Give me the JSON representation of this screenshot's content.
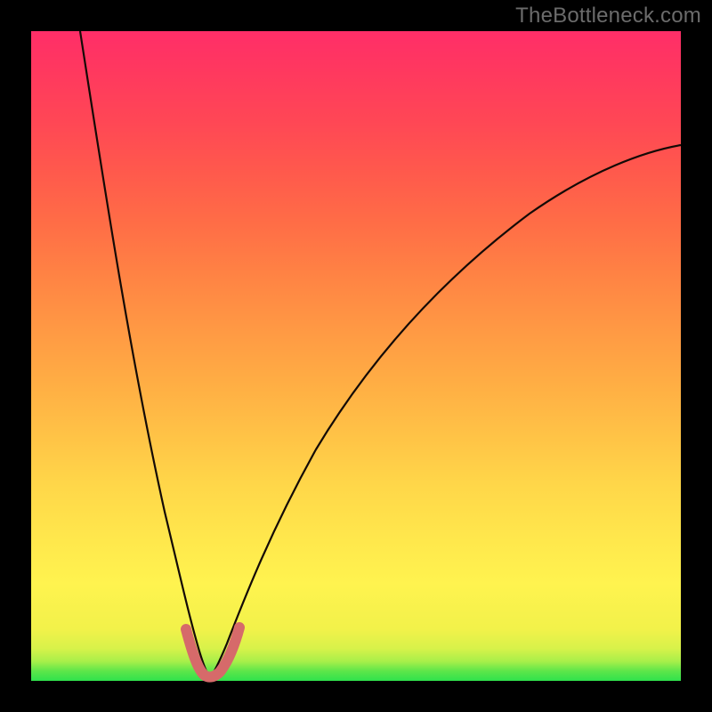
{
  "watermark": "TheBottleneck.com",
  "chart_data": {
    "type": "line",
    "title": "",
    "xlabel": "",
    "ylabel": "",
    "xlim": [
      0,
      1
    ],
    "ylim": [
      0,
      1
    ],
    "note": "Bottleneck dip curve. x is normalized component-balance axis (0..1), y is normalized bottleneck magnitude (0..1). Minimum at x≈0.27. Axes are unlabeled in the source image; values are pixel-fraction estimates.",
    "series": [
      {
        "name": "bottleneck-curve",
        "x": [
          0.075,
          0.1,
          0.13,
          0.16,
          0.19,
          0.22,
          0.245,
          0.26,
          0.27,
          0.28,
          0.3,
          0.32,
          0.35,
          0.4,
          0.45,
          0.52,
          0.6,
          0.7,
          0.8,
          0.9,
          1.0
        ],
        "y": [
          1.0,
          0.8,
          0.61,
          0.44,
          0.28,
          0.14,
          0.05,
          0.012,
          0.005,
          0.012,
          0.05,
          0.1,
          0.18,
          0.3,
          0.4,
          0.51,
          0.6,
          0.69,
          0.755,
          0.8,
          0.825
        ]
      },
      {
        "name": "highlight-segment",
        "x": [
          0.235,
          0.25,
          0.26,
          0.27,
          0.28,
          0.295,
          0.315
        ],
        "y": [
          0.075,
          0.025,
          0.01,
          0.005,
          0.01,
          0.03,
          0.085
        ]
      }
    ],
    "colors": {
      "curve": "#140a06",
      "highlight": "#d66a6a",
      "gradient_top": "#ff2e68",
      "gradient_mid": "#ffd749",
      "gradient_bottom": "#2fe24c",
      "frame": "#000000"
    }
  }
}
